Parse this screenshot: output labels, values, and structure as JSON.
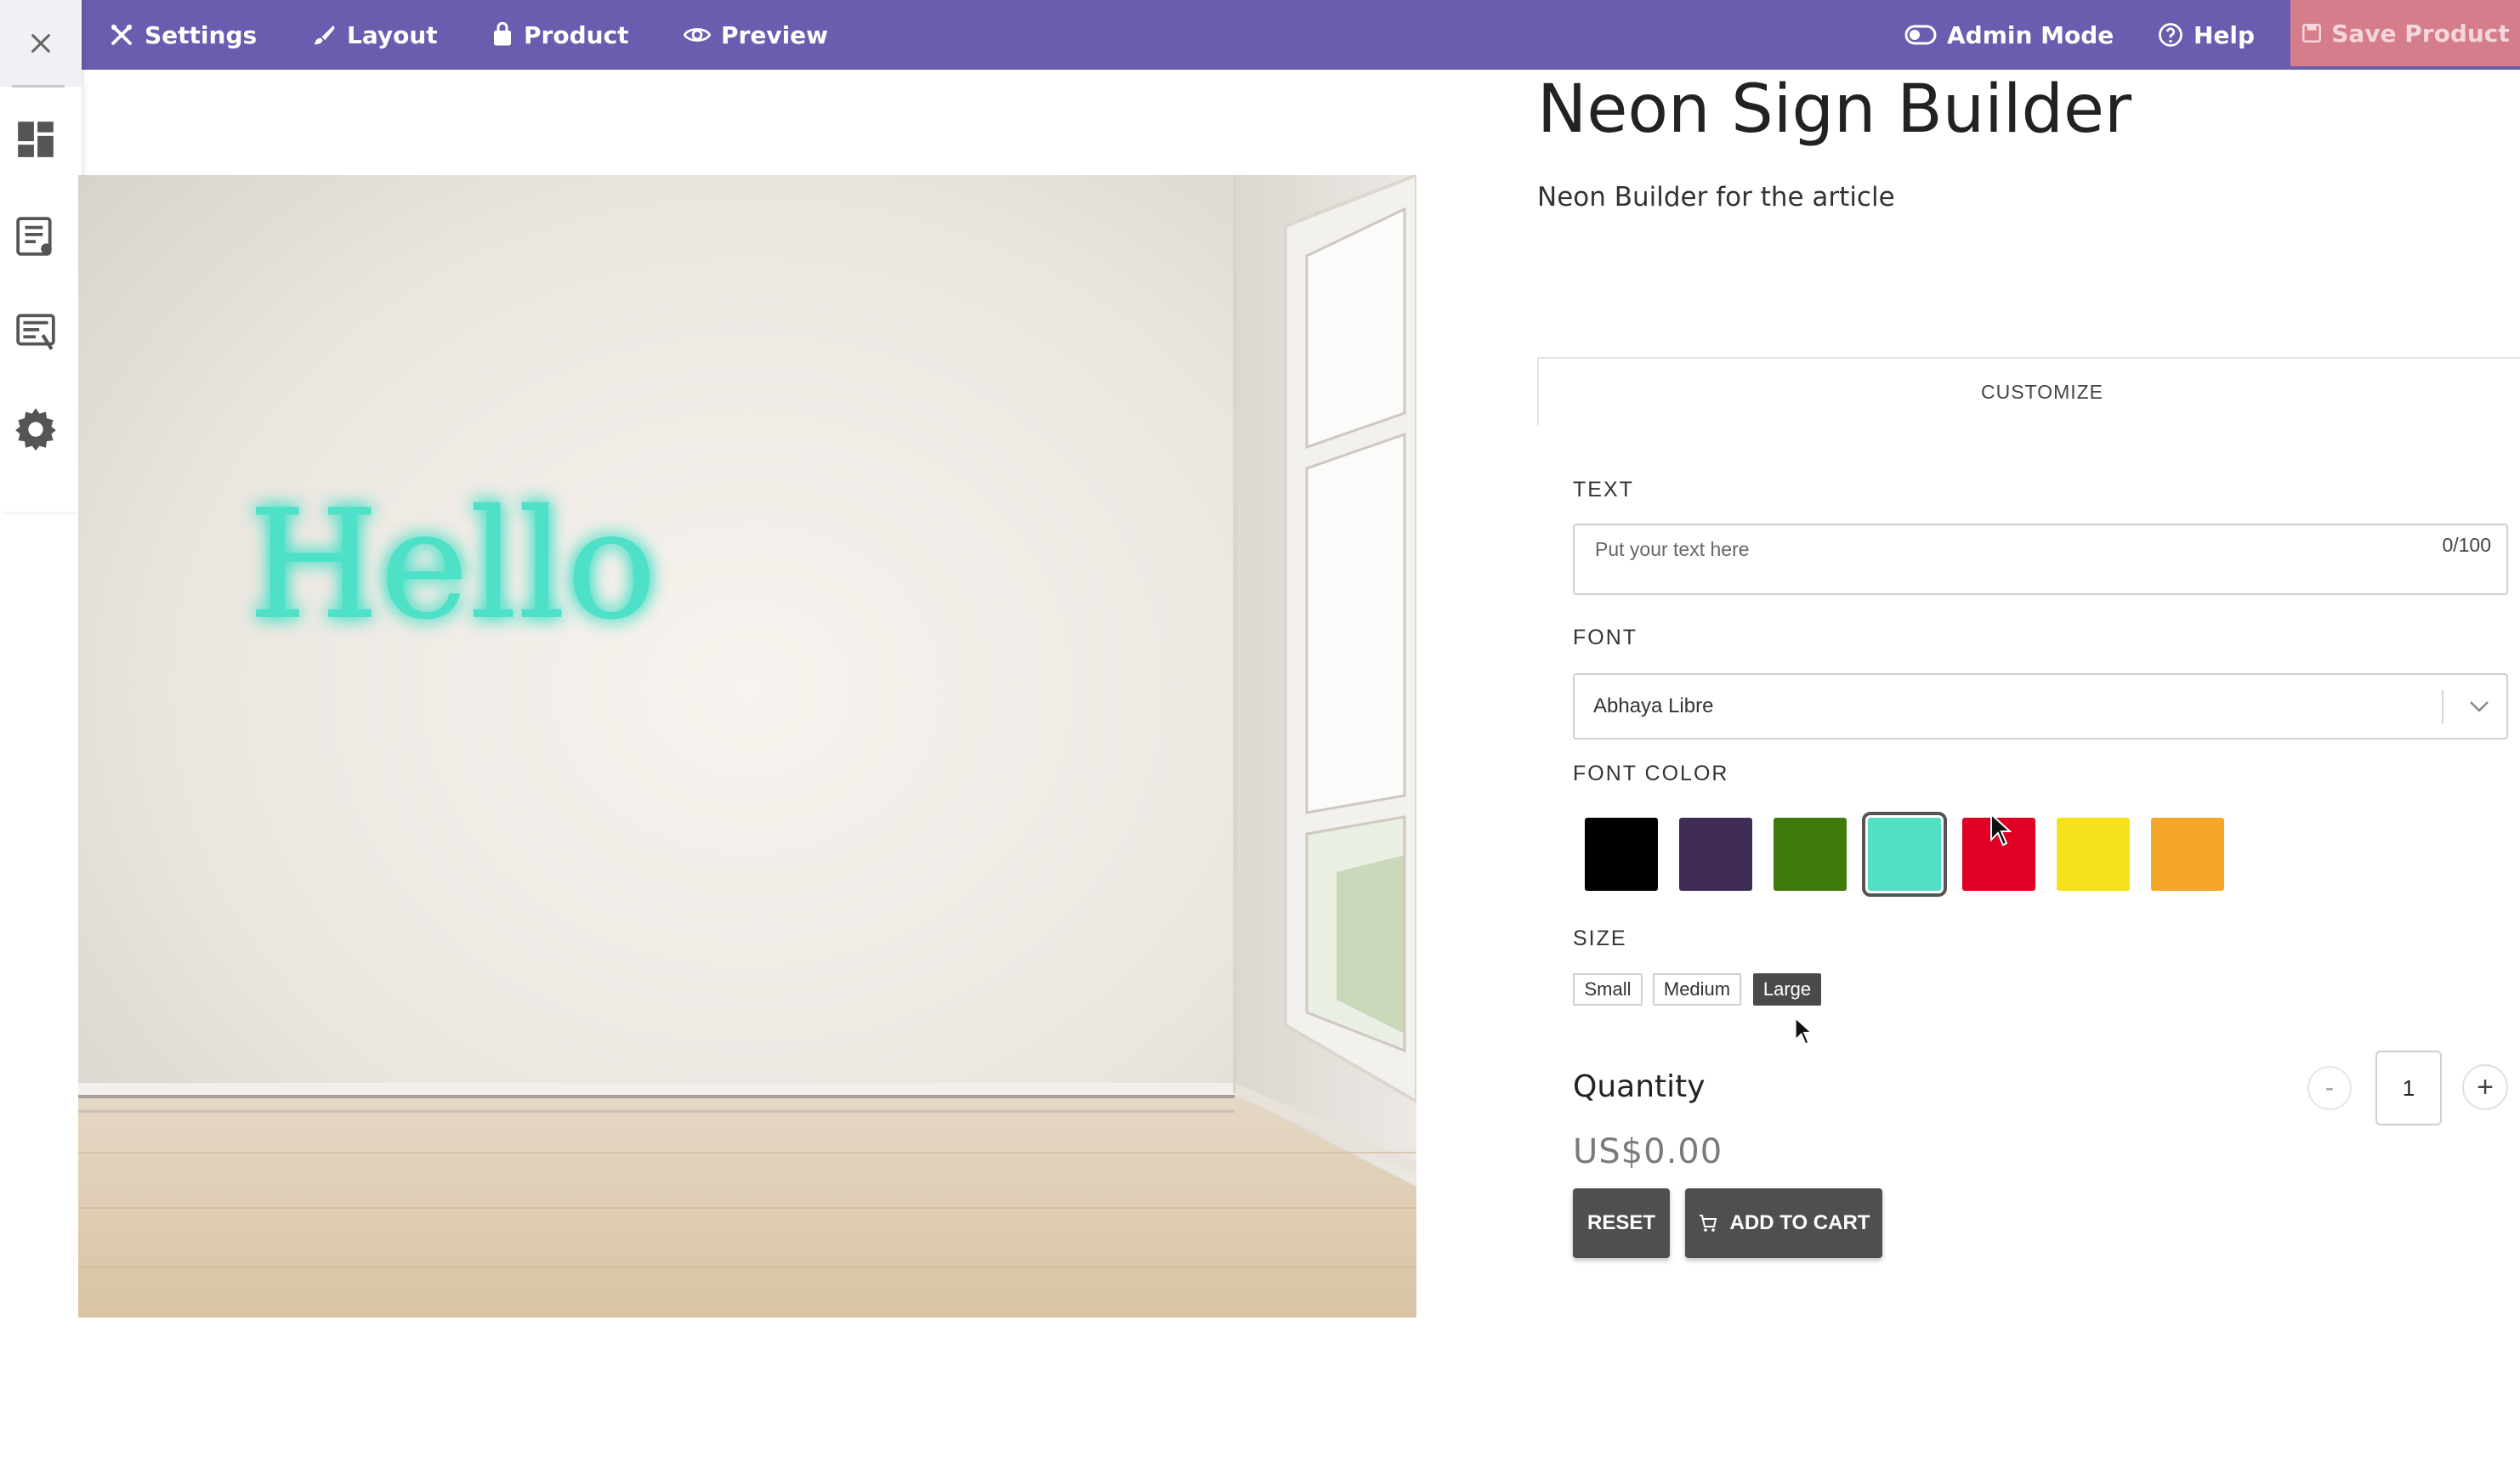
{
  "topbar": {
    "settings": "Settings",
    "layout": "Layout",
    "product": "Product",
    "preview": "Preview",
    "admin_mode": "Admin Mode",
    "help": "Help",
    "save_product": "Save Product"
  },
  "sidebar": {
    "icons": [
      "close-icon",
      "dashboard-icon",
      "list-icon",
      "list-settings-icon",
      "gear-icon"
    ]
  },
  "preview": {
    "neon_text": "Hello",
    "neon_color": "#4fe0c8"
  },
  "product": {
    "title": "Neon Sign Builder",
    "description": "Neon Builder for the article"
  },
  "customize": {
    "tab_label": "CUSTOMIZE",
    "text_label": "TEXT",
    "text_placeholder": "Put your text here",
    "text_value": "",
    "text_counter": "0/100",
    "font_label": "FONT",
    "font_value": "Abhaya Libre",
    "font_color_label": "FONT COLOR",
    "colors": [
      {
        "name": "black",
        "hex": "#000000",
        "selected": false
      },
      {
        "name": "purple",
        "hex": "#3f2d56",
        "selected": false
      },
      {
        "name": "green",
        "hex": "#3e7a0c",
        "selected": false
      },
      {
        "name": "turquoise",
        "hex": "#52e0c4",
        "selected": true
      },
      {
        "name": "red",
        "hex": "#e00024",
        "selected": false
      },
      {
        "name": "yellow",
        "hex": "#f6e21c",
        "selected": false
      },
      {
        "name": "orange",
        "hex": "#f4a72a",
        "selected": false
      }
    ],
    "size_label": "SIZE",
    "sizes": [
      "Small",
      "Medium",
      "Large"
    ],
    "selected_size": "Large"
  },
  "quantity": {
    "label": "Quantity",
    "minus": "-",
    "value": "1",
    "plus": "+"
  },
  "price": "US$0.00",
  "actions": {
    "reset": "RESET",
    "add_to_cart": "ADD TO CART"
  },
  "colors": {
    "topbar": "#6b5cb0",
    "save_button": "#d57d8a",
    "dark_button": "#4f4f4f"
  }
}
